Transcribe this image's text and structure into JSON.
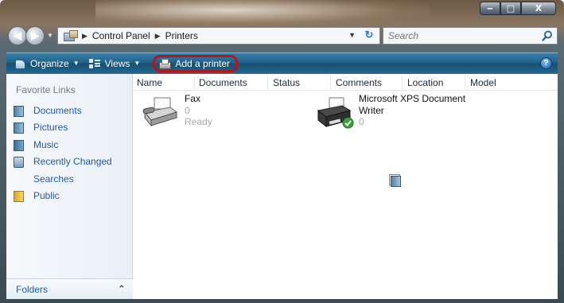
{
  "window": {
    "minimize_glyph": "‒",
    "maximize_glyph": "□",
    "close_glyph": "X"
  },
  "navigation": {
    "back_glyph": "◀",
    "forward_glyph": "▶",
    "dropdown_glyph": "▼",
    "breadcrumbs": [
      "Control Panel",
      "Printers"
    ],
    "separator_glyph": "▶",
    "refresh_glyph": "↻"
  },
  "search": {
    "placeholder": "Search",
    "icon": "magnifier-icon"
  },
  "toolbar": {
    "organize_label": "Organize",
    "views_label": "Views",
    "add_printer_label": "Add a printer",
    "caret_glyph": "▼",
    "help_glyph": "?",
    "highlight_color": "#b0181b"
  },
  "sidebar": {
    "title": "Favorite Links",
    "items": [
      {
        "label": "Documents",
        "icon": "documents-icon"
      },
      {
        "label": "Pictures",
        "icon": "pictures-icon"
      },
      {
        "label": "Music",
        "icon": "music-icon"
      },
      {
        "label": "Recently Changed",
        "icon": "recently-changed-icon"
      },
      {
        "label": "Searches",
        "icon": "searches-icon"
      },
      {
        "label": "Public",
        "icon": "public-folder-icon"
      }
    ],
    "folders_label": "Folders",
    "folders_chevron": "⌃"
  },
  "columns": [
    "Name",
    "Documents",
    "Status",
    "Comments",
    "Location",
    "Model"
  ],
  "printers": [
    {
      "name": "Fax",
      "documents": "0",
      "status": "Ready",
      "icon": "fax-icon"
    },
    {
      "name_line1": "Microsoft XPS Document",
      "name_line2": "Writer",
      "documents": "0",
      "icon": "xps-printer-icon",
      "default": true
    }
  ],
  "colors": {
    "link": "#1e5aa8",
    "toolbar": "#1e5f86",
    "accent": "#1f7ad1"
  }
}
